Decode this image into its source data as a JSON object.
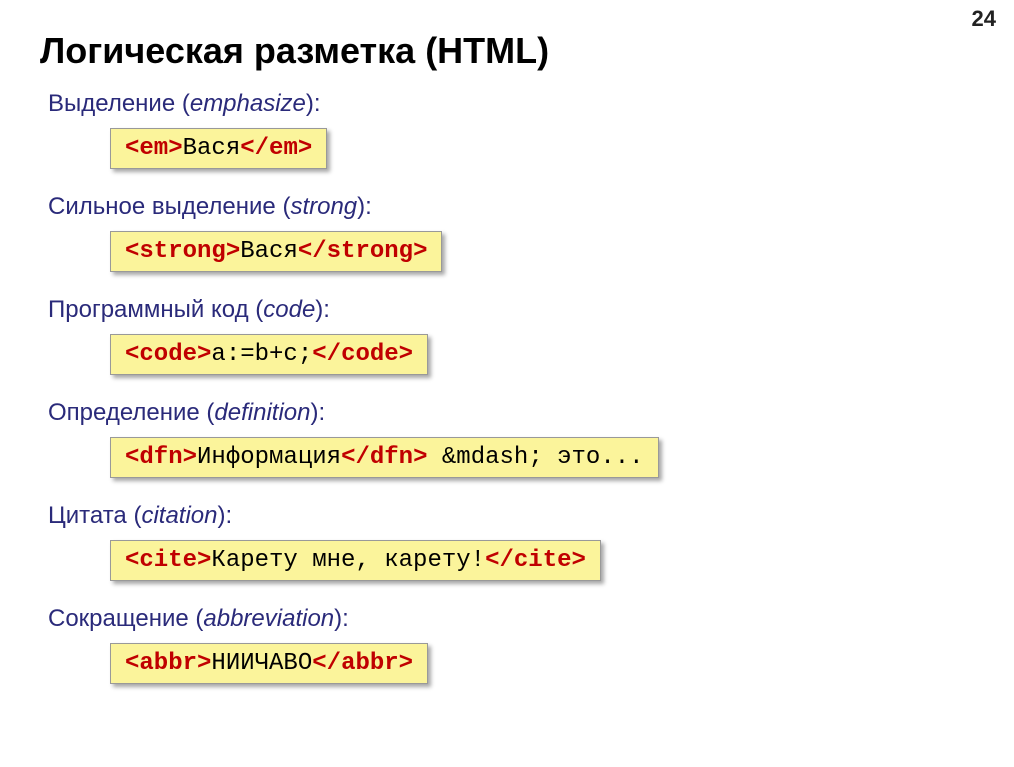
{
  "page_number": "24",
  "title": "Логическая разметка (HTML)",
  "sections": [
    {
      "label_ru": "Выделение",
      "label_en": "emphasize",
      "tag": "em",
      "content": "Вася"
    },
    {
      "label_ru": "Сильное выделение",
      "label_en": "strong",
      "tag": "strong",
      "content": "Вася"
    },
    {
      "label_ru": "Программный код",
      "label_en": "code",
      "tag": "code",
      "content": "a:=b+c;"
    },
    {
      "label_ru": "Определение",
      "label_en": "definition",
      "tag": "dfn",
      "content": "Информация",
      "after": " &mdash; это..."
    },
    {
      "label_ru": "Цитата",
      "label_en": "citation",
      "tag": "cite",
      "content": "Карету мне, карету!"
    },
    {
      "label_ru": "Сокращение",
      "label_en": "abbreviation",
      "tag": "abbr",
      "content": "НИИЧАВО"
    }
  ]
}
